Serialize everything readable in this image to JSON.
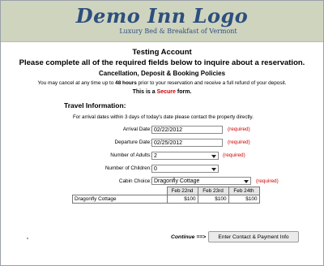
{
  "header": {
    "logo": "Demo Inn Logo",
    "tagline": "Luxury Bed & Breakfast of Vermont"
  },
  "intro": {
    "title": "Testing Account",
    "subtitle": "Please complete all of the required fields below to inquire about a reservation.",
    "policy_heading": "Cancellation, Deposit & Booking Policies",
    "cancel_pre": "You may cancel at any time up to ",
    "cancel_hours": "48 hours",
    "cancel_post": " prior to your reservation and receive a full refund of your deposit.",
    "secure_pre": "This is a ",
    "secure_word": "Secure",
    "secure_post": " form."
  },
  "travel": {
    "heading": "Travel Information:",
    "note": "For arrival dates within 3 days of today's date please contact the property directly.",
    "required_label": "(required)",
    "arrival_label": "Arrival Date:",
    "arrival_value": "02/22/2012",
    "departure_label": "Departure Date:",
    "departure_value": "02/25/2012",
    "adults_label": "Number of Adults:",
    "adults_value": "2",
    "children_label": "Number of Children:",
    "children_value": "0",
    "cabin_label": "Cabin Choice:",
    "cabin_value": "Dragonfly Cottage"
  },
  "rates": {
    "columns": [
      "Feb 22nd",
      "Feb 23rd",
      "Feb 24th"
    ],
    "rows": [
      {
        "name": "Dragonfly Cottage",
        "values": [
          "$100",
          "$100",
          "$100"
        ]
      }
    ]
  },
  "footer": {
    "continue_label": "Continue ==>",
    "button_label": "Enter Contact & Payment Info"
  }
}
